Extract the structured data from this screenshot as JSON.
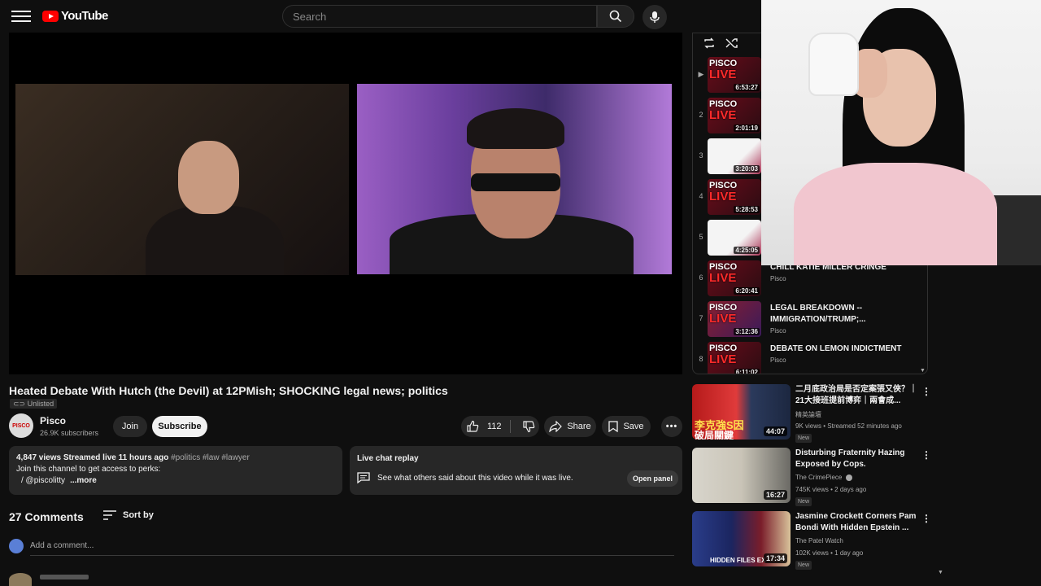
{
  "header": {
    "logo_text": "YouTube",
    "search_placeholder": "Search"
  },
  "video": {
    "title": "Heated Debate With Hutch (the Devil) at 12PMish; SHOCKING legal news; politics",
    "visibility": "Unlisted"
  },
  "channel": {
    "name": "Pisco",
    "avatar_text": "PISCO",
    "subscribers": "26.9K subscribers",
    "join_label": "Join",
    "subscribe_label": "Subscribe"
  },
  "actions": {
    "likes": "112",
    "share_label": "Share",
    "save_label": "Save"
  },
  "description": {
    "stats": "4,847 views  Streamed live 11 hours ago",
    "tags": "#politics #law #lawyer",
    "line2": "Join this channel to get access to perks:",
    "line3": "/ @piscolitty",
    "more": "...more"
  },
  "chat_replay": {
    "title": "Live chat replay",
    "subtitle": "See what others said about this video while it was live.",
    "button": "Open panel"
  },
  "comments": {
    "count_label": "27 Comments",
    "sort_label": "Sort by",
    "placeholder": "Add a comment..."
  },
  "playlist": {
    "items": [
      {
        "index": "▶",
        "duration": "6:53:27",
        "title": "",
        "channel": ""
      },
      {
        "index": "2",
        "duration": "2:01:19",
        "title": "",
        "channel": ""
      },
      {
        "index": "3",
        "duration": "3:20:03",
        "title": "",
        "channel": ""
      },
      {
        "index": "4",
        "duration": "5:28:53",
        "title": "",
        "channel": ""
      },
      {
        "index": "5",
        "duration": "4:25:05",
        "title": "",
        "channel": ""
      },
      {
        "index": "6",
        "duration": "6:20:41",
        "title": "CHILL KATIE MILLER CRINGE",
        "channel": "Pisco"
      },
      {
        "index": "7",
        "duration": "3:12:36",
        "title": "LEGAL BREAKDOWN -- IMMIGRATION/TRUMP;...",
        "channel": "Pisco"
      },
      {
        "index": "8",
        "duration": "6:11:02",
        "title": "DEBATE ON LEMON INDICTMENT",
        "channel": "Pisco"
      }
    ],
    "thumb_brand_top": "PISCO",
    "thumb_brand_bottom": "LIVE"
  },
  "recommendations": [
    {
      "title": "二月底政治局是否定案張又俠？｜21大接班提前博弈｜兩會成...",
      "channel": "精英論壇",
      "meta": "9K views • Streamed 52 minutes ago",
      "badge": "New",
      "duration": "44:07",
      "thumb_text": "李克強S因",
      "thumb_text2": "破局關鍵"
    },
    {
      "title": "Disturbing Fraternity Hazing Exposed by Cops.",
      "channel": "The CrimePiece",
      "meta": "745K views • 2 days ago",
      "badge": "New",
      "duration": "16:27"
    },
    {
      "title": "Jasmine Crockett Corners Pam Bondi With Hidden Epstein ...",
      "channel": "The Patel Watch",
      "meta": "102K views • 1 day ago",
      "badge": "New",
      "duration": "17:34",
      "thumb_text": "HIDDEN FILES EX"
    }
  ]
}
